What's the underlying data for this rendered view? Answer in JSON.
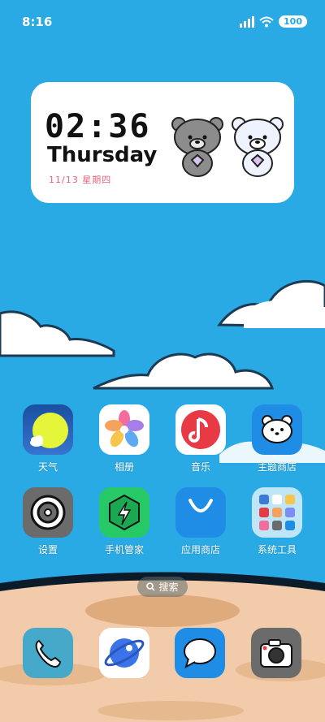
{
  "status_bar": {
    "time": "8:16",
    "battery": "100",
    "icons": [
      "signal-icon",
      "wifi-icon",
      "battery-icon"
    ]
  },
  "widget": {
    "time": "02:36",
    "day": "Thursday",
    "date": "11/13 星期四"
  },
  "apps_row1": [
    {
      "label": "天气",
      "icon": "weather-icon"
    },
    {
      "label": "相册",
      "icon": "photos-icon"
    },
    {
      "label": "音乐",
      "icon": "music-icon"
    },
    {
      "label": "主题商店",
      "icon": "theme-store-icon"
    }
  ],
  "apps_row2": [
    {
      "label": "设置",
      "icon": "settings-icon"
    },
    {
      "label": "手机管家",
      "icon": "phone-manager-icon"
    },
    {
      "label": "应用商店",
      "icon": "app-store-icon"
    },
    {
      "label": "系统工具",
      "icon": "system-tools-folder"
    }
  ],
  "search": {
    "label": "搜索"
  },
  "dock": [
    "phone-icon",
    "browser-icon",
    "messages-icon",
    "camera-icon"
  ],
  "colors": {
    "sky": "#2aaae4",
    "sand": "#f2ccaa",
    "accent_pink": "#e8607f"
  }
}
